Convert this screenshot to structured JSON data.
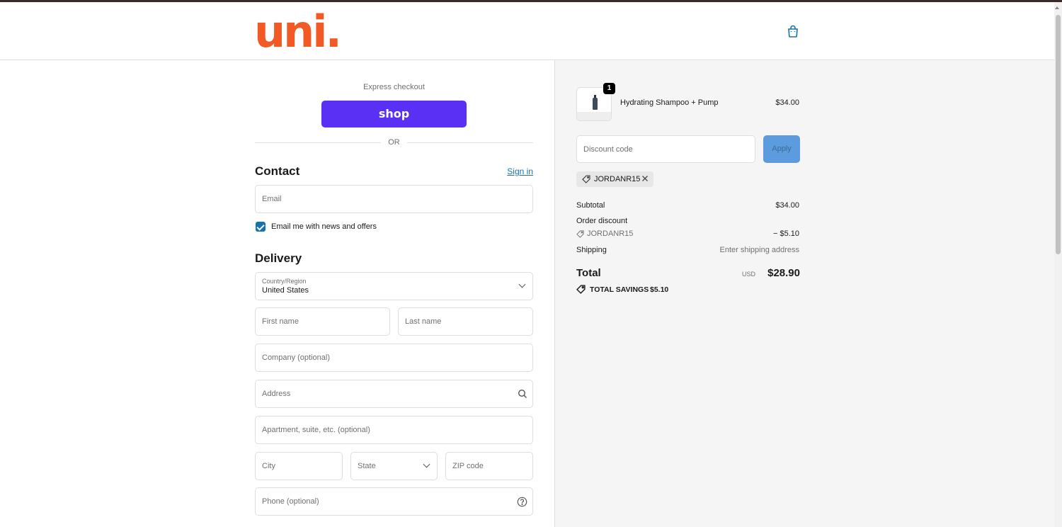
{
  "header": {
    "logo_text": "uni.",
    "brand_color": "#f15a24",
    "cart_icon": "shopping-bag-icon"
  },
  "express": {
    "label": "Express checkout",
    "shop_button": "shop",
    "shop_color": "#5a31f4",
    "divider_text": "OR"
  },
  "contact": {
    "title": "Contact",
    "sign_in": "Sign in",
    "email_placeholder": "Email",
    "newsletter_label": "Email me with news and offers",
    "newsletter_checked": true
  },
  "delivery": {
    "title": "Delivery",
    "country_label": "Country/Region",
    "country_value": "United States",
    "first_name": "First name",
    "last_name": "Last name",
    "company": "Company (optional)",
    "address": "Address",
    "apartment": "Apartment, suite, etc. (optional)",
    "city": "City",
    "state": "State",
    "zip": "ZIP code",
    "phone": "Phone (optional)"
  },
  "summary": {
    "product": {
      "name": "Hydrating Shampoo + Pump",
      "price": "$34.00",
      "quantity": "1"
    },
    "discount_placeholder": "Discount code",
    "apply_label": "Apply",
    "applied_code": "JORDANR15",
    "subtotal_label": "Subtotal",
    "subtotal_value": "$34.00",
    "order_discount_label": "Order discount",
    "discount_code": "JORDANR15",
    "discount_value": "− $5.10",
    "shipping_label": "Shipping",
    "shipping_value": "Enter shipping address",
    "total_label": "Total",
    "currency": "USD",
    "total_value": "$28.90",
    "savings_label": "TOTAL SAVINGS",
    "savings_value": "$5.10"
  }
}
